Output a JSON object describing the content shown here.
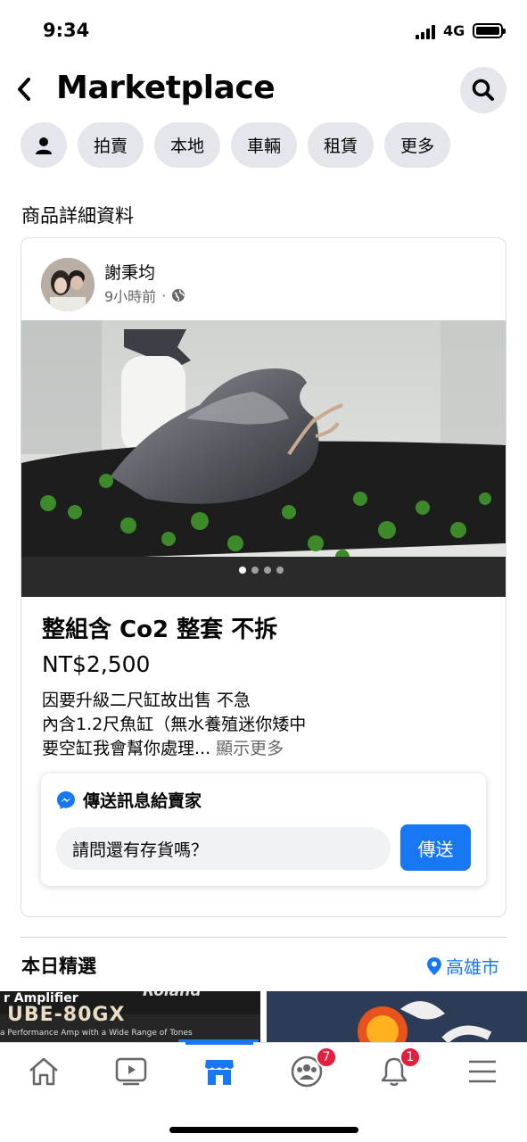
{
  "status": {
    "time": "9:34",
    "network": "4G"
  },
  "header": {
    "title": "Marketplace"
  },
  "chips": [
    "拍賣",
    "本地",
    "車輛",
    "租賃",
    "更多"
  ],
  "section_title": "商品詳細資料",
  "listing": {
    "seller": "謝秉均",
    "time_ago": "9小時前",
    "title": "整組含 Co2 整套 不拆",
    "price": "NT$2,500",
    "desc_line1": "因要升級二尺缸故出售 不急",
    "desc_line2": "內含1.2尺魚缸（無水養殖迷你矮中",
    "desc_line3": "要空缸我會幫你處理...",
    "more_link": "顯示更多",
    "photo_count": 4,
    "active_photo": 1
  },
  "message": {
    "header": "傳送訊息給賣家",
    "input_value": "請問還有存貨嗎？",
    "send_label": "傳送"
  },
  "today": {
    "title": "本日精選",
    "location": "高雄市"
  },
  "thumbs": {
    "thumb1_brand": "Roland",
    "thumb1_line1": "r Amplifier",
    "thumb1_line2": "UBE-80GX",
    "thumb1_line3": "a Performance Amp with a Wide Range of Tones"
  },
  "tabbar": {
    "groups_badge": "7",
    "notifications_badge": "1"
  },
  "colors": {
    "accent": "#1877f2",
    "badge": "#e41e3f",
    "chip_bg": "#e4e6eb"
  }
}
